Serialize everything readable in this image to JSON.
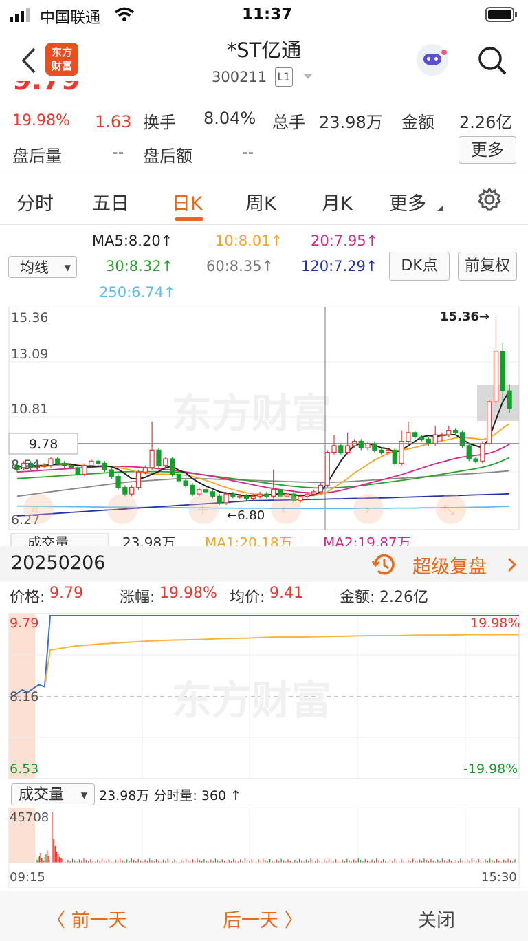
{
  "status": {
    "carrier": "中国联通",
    "time": "11:37"
  },
  "header": {
    "title": "*ST亿通",
    "code": "300211",
    "level": "L1",
    "logo_text_1": "东方",
    "logo_text_2": "财富"
  },
  "quote": {
    "change_pct": "19.98%",
    "change": "1.63",
    "turnover_label": "换手",
    "turnover": "8.04%",
    "volume_label": "总手",
    "volume": "23.98万",
    "amount_label": "金额",
    "amount": "2.26亿",
    "after_vol_label": "盘后量",
    "after_vol": "--",
    "after_amt_label": "盘后额",
    "after_amt": "--",
    "more_label": "更多"
  },
  "tabs": [
    "分时",
    "五日",
    "日K",
    "周K",
    "月K",
    "更多"
  ],
  "active_tab": "日K",
  "ma": {
    "selector": "均线",
    "ma5": "MA5:8.20↑",
    "ma10": "10:8.01↑",
    "ma20": "20:7.95↑",
    "ma30": "30:8.32↑",
    "ma60": "60:8.35↑",
    "ma120": "120:7.29↑",
    "ma250": "250:6.74↑",
    "dk": "DK点",
    "fq": "前复权"
  },
  "colors": {
    "red": "#e8382f",
    "green": "#12a02a",
    "accent": "#e86a1a",
    "ma5": "#222222",
    "ma10": "#f5a623",
    "ma20": "#d6288a",
    "ma30": "#2ca02c",
    "ma60": "#888888",
    "ma120": "#2233aa",
    "ma250": "#5bbcf0"
  },
  "kline": {
    "y_labels": [
      "15.36",
      "13.09",
      "10.81",
      "8.54",
      "6.27"
    ],
    "current_label": "9.78",
    "high_label": "15.36→",
    "low_label": "←6.80",
    "watermark": "东方财富",
    "candles": [
      [
        8.6,
        8.4,
        8.7,
        8.3
      ],
      [
        8.5,
        8.7,
        8.8,
        8.4
      ],
      [
        8.7,
        8.5,
        8.8,
        8.4
      ],
      [
        8.5,
        8.6,
        8.8,
        8.4
      ],
      [
        8.6,
        8.6,
        8.7,
        8.5
      ],
      [
        8.6,
        8.9,
        9.0,
        8.5
      ],
      [
        8.9,
        8.7,
        9.0,
        8.6
      ],
      [
        8.7,
        8.6,
        8.8,
        8.5
      ],
      [
        8.6,
        8.5,
        8.7,
        8.4
      ],
      [
        8.5,
        8.2,
        8.6,
        8.1
      ],
      [
        8.2,
        8.6,
        8.7,
        8.1
      ],
      [
        8.6,
        8.8,
        8.9,
        8.5
      ],
      [
        8.8,
        8.7,
        8.9,
        8.6
      ],
      [
        8.7,
        8.4,
        8.8,
        8.3
      ],
      [
        8.4,
        8.1,
        8.5,
        8.0
      ],
      [
        8.1,
        7.6,
        8.2,
        7.5
      ],
      [
        7.6,
        7.3,
        7.7,
        7.2
      ],
      [
        7.3,
        7.6,
        7.7,
        7.2
      ],
      [
        7.6,
        8.3,
        8.4,
        7.5
      ],
      [
        8.3,
        8.5,
        8.6,
        8.2
      ],
      [
        8.5,
        9.3,
        10.6,
        8.4
      ],
      [
        9.3,
        8.6,
        9.4,
        8.5
      ],
      [
        8.6,
        8.9,
        9.0,
        8.5
      ],
      [
        8.9,
        8.2,
        9.0,
        8.1
      ],
      [
        8.2,
        7.9,
        8.3,
        7.8
      ],
      [
        7.9,
        7.7,
        8.0,
        7.6
      ],
      [
        7.7,
        7.3,
        7.8,
        7.2
      ],
      [
        7.3,
        7.5,
        7.6,
        7.2
      ],
      [
        7.5,
        7.4,
        7.6,
        7.3
      ],
      [
        7.4,
        7.2,
        7.5,
        7.1
      ],
      [
        7.2,
        6.9,
        7.3,
        6.8
      ],
      [
        6.9,
        7.3,
        7.4,
        6.8
      ],
      [
        7.3,
        7.2,
        7.4,
        7.1
      ],
      [
        7.2,
        7.2,
        7.3,
        7.1
      ],
      [
        7.2,
        7.1,
        7.3,
        7.0
      ],
      [
        7.1,
        7.2,
        7.3,
        7.0
      ],
      [
        7.2,
        7.3,
        7.4,
        7.1
      ],
      [
        7.3,
        7.2,
        7.4,
        7.1
      ],
      [
        7.2,
        7.5,
        8.4,
        7.1
      ],
      [
        7.5,
        7.2,
        7.6,
        7.1
      ],
      [
        7.2,
        7.3,
        7.4,
        7.1
      ],
      [
        7.3,
        7.0,
        7.4,
        6.9
      ],
      [
        7.0,
        7.2,
        7.3,
        6.9
      ],
      [
        7.2,
        7.3,
        7.4,
        7.1
      ],
      [
        7.3,
        7.4,
        7.5,
        7.2
      ],
      [
        7.4,
        7.7,
        7.8,
        7.3
      ],
      [
        7.7,
        9.2,
        9.3,
        7.6
      ],
      [
        9.2,
        9.5,
        10.0,
        9.1
      ],
      [
        9.5,
        9.2,
        9.6,
        9.1
      ],
      [
        9.2,
        9.5,
        10.1,
        9.1
      ],
      [
        9.5,
        9.7,
        9.8,
        9.4
      ],
      [
        9.7,
        9.4,
        9.8,
        9.3
      ],
      [
        9.4,
        9.6,
        9.7,
        9.3
      ],
      [
        9.6,
        9.3,
        9.7,
        9.2
      ],
      [
        9.3,
        9.2,
        9.4,
        9.1
      ],
      [
        9.2,
        9.3,
        9.4,
        9.1
      ],
      [
        9.3,
        8.7,
        9.4,
        8.6
      ],
      [
        8.7,
        9.7,
        10.2,
        8.6
      ],
      [
        9.7,
        10.1,
        10.6,
        9.6
      ],
      [
        10.1,
        9.9,
        10.2,
        9.8
      ],
      [
        9.9,
        9.8,
        10.0,
        9.7
      ],
      [
        9.8,
        9.6,
        9.9,
        9.5
      ],
      [
        9.6,
        10.0,
        10.4,
        9.5
      ],
      [
        10.0,
        10.0,
        10.1,
        9.7
      ],
      [
        10.0,
        10.2,
        10.4,
        9.9
      ],
      [
        10.2,
        10.1,
        10.3,
        10.0
      ],
      [
        10.1,
        9.5,
        10.2,
        9.4
      ],
      [
        9.5,
        8.9,
        9.6,
        8.8
      ],
      [
        8.9,
        8.8,
        9.0,
        8.7
      ],
      [
        8.8,
        9.6,
        9.7,
        8.7
      ],
      [
        9.6,
        11.5,
        11.6,
        9.5
      ],
      [
        11.5,
        13.8,
        15.36,
        11.4
      ],
      [
        13.8,
        12.0,
        14.2,
        11.4
      ],
      [
        12.0,
        11.2,
        12.3,
        11.0
      ]
    ],
    "ma5": [
      8.55,
      8.56,
      8.58,
      8.6,
      8.6,
      8.64,
      8.66,
      8.68,
      8.66,
      8.6,
      8.56,
      8.54,
      8.56,
      8.58,
      8.54,
      8.42,
      8.22,
      8.0,
      7.98,
      8.06,
      8.2,
      8.32,
      8.5,
      8.56,
      8.38,
      8.26,
      8.0,
      7.82,
      7.66,
      7.54,
      7.4,
      7.34,
      7.3,
      7.26,
      7.2,
      7.24,
      7.26,
      7.24,
      7.3,
      7.3,
      7.3,
      7.26,
      7.24,
      7.24,
      7.26,
      7.4,
      7.8,
      8.3,
      8.8,
      9.2,
      9.5,
      9.6,
      9.58,
      9.52,
      9.4,
      9.36,
      9.2,
      9.3,
      9.5,
      9.7,
      9.9,
      9.96,
      9.92,
      9.96,
      10.0,
      10.0,
      9.8,
      9.6,
      9.5,
      9.4,
      9.85,
      10.7,
      11.5,
      12.0
    ],
    "ma10": [
      8.5,
      8.5,
      8.5,
      8.55,
      8.56,
      8.58,
      8.6,
      8.62,
      8.63,
      8.62,
      8.6,
      8.58,
      8.57,
      8.56,
      8.54,
      8.5,
      8.45,
      8.38,
      8.3,
      8.25,
      8.22,
      8.2,
      8.2,
      8.2,
      8.18,
      8.15,
      8.1,
      8.02,
      7.92,
      7.82,
      7.7,
      7.6,
      7.5,
      7.42,
      7.36,
      7.3,
      7.28,
      7.26,
      7.26,
      7.26,
      7.25,
      7.24,
      7.24,
      7.24,
      7.24,
      7.28,
      7.4,
      7.6,
      7.8,
      8.0,
      8.25,
      8.45,
      8.65,
      8.85,
      9.0,
      9.15,
      9.25,
      9.3,
      9.35,
      9.42,
      9.5,
      9.58,
      9.66,
      9.72,
      9.78,
      9.85,
      9.88,
      9.85,
      9.82,
      9.78,
      9.85,
      10.05,
      10.3,
      10.5
    ],
    "ma20": [
      8.3,
      8.32,
      8.34,
      8.36,
      8.38,
      8.4,
      8.42,
      8.44,
      8.46,
      8.48,
      8.5,
      8.52,
      8.54,
      8.55,
      8.56,
      8.56,
      8.55,
      8.54,
      8.52,
      8.5,
      8.48,
      8.45,
      8.42,
      8.38,
      8.34,
      8.3,
      8.25,
      8.2,
      8.15,
      8.1,
      8.04,
      7.98,
      7.9,
      7.84,
      7.78,
      7.72,
      7.66,
      7.6,
      7.55,
      7.5,
      7.46,
      7.42,
      7.38,
      7.36,
      7.34,
      7.34,
      7.36,
      7.4,
      7.46,
      7.54,
      7.62,
      7.7,
      7.78,
      7.86,
      7.94,
      8.02,
      8.1,
      8.18,
      8.28,
      8.38,
      8.48,
      8.58,
      8.68,
      8.76,
      8.84,
      8.92,
      8.98,
      9.02,
      9.06,
      9.1,
      9.16,
      9.26,
      9.4,
      9.56
    ],
    "ma30": [
      8.0,
      8.02,
      8.04,
      8.06,
      8.08,
      8.1,
      8.12,
      8.14,
      8.16,
      8.18,
      8.2,
      8.22,
      8.24,
      8.26,
      8.28,
      8.3,
      8.31,
      8.32,
      8.32,
      8.32,
      8.32,
      8.32,
      8.31,
      8.3,
      8.28,
      8.26,
      8.24,
      8.2,
      8.16,
      8.12,
      8.08,
      8.04,
      8.0,
      7.96,
      7.92,
      7.88,
      7.84,
      7.8,
      7.76,
      7.72,
      7.68,
      7.65,
      7.62,
      7.6,
      7.58,
      7.57,
      7.57,
      7.58,
      7.6,
      7.62,
      7.65,
      7.68,
      7.72,
      7.76,
      7.8,
      7.84,
      7.88,
      7.92,
      7.96,
      8.0,
      8.05,
      8.1,
      8.15,
      8.2,
      8.25,
      8.3,
      8.35,
      8.4,
      8.45,
      8.52,
      8.6,
      8.7,
      8.82,
      8.95
    ],
    "ma60": [
      7.2,
      7.24,
      7.28,
      7.32,
      7.36,
      7.4,
      7.44,
      7.48,
      7.52,
      7.56,
      7.6,
      7.64,
      7.68,
      7.72,
      7.76,
      7.8,
      7.83,
      7.86,
      7.88,
      7.9,
      7.92,
      7.94,
      7.96,
      7.98,
      8.0,
      8.0,
      8.0,
      8.0,
      7.99,
      7.98,
      7.97,
      7.96,
      7.95,
      7.94,
      7.93,
      7.92,
      7.91,
      7.9,
      7.89,
      7.88,
      7.87,
      7.86,
      7.85,
      7.84,
      7.83,
      7.83,
      7.83,
      7.84,
      7.85,
      7.86,
      7.88,
      7.9,
      7.92,
      7.94,
      7.96,
      7.98,
      8.0,
      8.02,
      8.04,
      8.06,
      8.08,
      8.1,
      8.12,
      8.14,
      8.16,
      8.18,
      8.2,
      8.22,
      8.24,
      8.26,
      8.28,
      8.3,
      8.33,
      8.36
    ],
    "ma120": [
      6.3,
      6.32,
      6.34,
      6.36,
      6.38,
      6.4,
      6.42,
      6.44,
      6.46,
      6.48,
      6.5,
      6.52,
      6.54,
      6.56,
      6.58,
      6.6,
      6.62,
      6.64,
      6.66,
      6.68,
      6.7,
      6.72,
      6.74,
      6.76,
      6.78,
      6.8,
      6.82,
      6.84,
      6.86,
      6.88,
      6.9,
      6.92,
      6.94,
      6.96,
      6.98,
      7.0,
      7.0,
      7.01,
      7.02,
      7.02,
      7.03,
      7.04,
      7.04,
      7.05,
      7.06,
      7.06,
      7.07,
      7.08,
      7.08,
      7.09,
      7.1,
      7.1,
      7.11,
      7.12,
      7.12,
      7.13,
      7.14,
      7.15,
      7.16,
      7.17,
      7.18,
      7.19,
      7.2,
      7.21,
      7.22,
      7.23,
      7.24,
      7.25,
      7.26,
      7.27,
      7.28,
      7.29,
      7.3,
      7.31
    ],
    "ma250": [
      6.75,
      6.75,
      6.74,
      6.74,
      6.74,
      6.73,
      6.73,
      6.73,
      6.72,
      6.72,
      6.72,
      6.71,
      6.71,
      6.7,
      6.7,
      6.7,
      6.7,
      6.69,
      6.69,
      6.69,
      6.69,
      6.68,
      6.68,
      6.68,
      6.68,
      6.67,
      6.67,
      6.67,
      6.67,
      6.66,
      6.66,
      6.66,
      6.66,
      6.65,
      6.65,
      6.65,
      6.65,
      6.65,
      6.64,
      6.64,
      6.64,
      6.64,
      6.64,
      6.64,
      6.64,
      6.64,
      6.64,
      6.64,
      6.64,
      6.64,
      6.64,
      6.65,
      6.65,
      6.65,
      6.65,
      6.65,
      6.66,
      6.66,
      6.66,
      6.66,
      6.67,
      6.67,
      6.67,
      6.68,
      6.68,
      6.68,
      6.69,
      6.69,
      6.7,
      6.7,
      6.71,
      6.72,
      6.73,
      6.74
    ],
    "vol_partial": {
      "selector": "成交量",
      "vol": "23.98万",
      "ma1": "MA1:20.18万",
      "ma2": "MA2:19.87万"
    }
  },
  "detail": {
    "date": "20250206",
    "replay": "超级复盘",
    "price_label": "价格:",
    "price": "9.79",
    "chg_label": "涨幅:",
    "chg": "19.98%",
    "avg_label": "均价:",
    "avg": "9.41",
    "amt_label": "金额:",
    "amt": "2.26亿"
  },
  "intraday": {
    "top": "9.79",
    "mid": "8.16",
    "bottom": "6.53",
    "top_pct": "19.98%",
    "bottom_pct": "-19.98%",
    "watermark": "东方财富",
    "price": [
      8.16,
      8.22,
      8.3,
      8.25,
      8.33,
      8.4,
      8.36,
      9.79
    ],
    "avg": [
      9.1,
      9.18,
      9.22,
      9.25,
      9.28,
      9.3,
      9.31,
      9.33,
      9.34,
      9.36,
      9.36,
      9.37,
      9.38,
      9.39,
      9.39,
      9.4,
      9.4,
      9.41,
      9.41,
      9.41
    ]
  },
  "volume": {
    "selector": "成交量",
    "summary": "23.98万 分时量: 360 ↑",
    "max": "45708",
    "start": "09:15",
    "end": "15:30"
  },
  "footer": {
    "prev": "〈 前一天",
    "next": "后一天 〉",
    "close": "关闭"
  }
}
